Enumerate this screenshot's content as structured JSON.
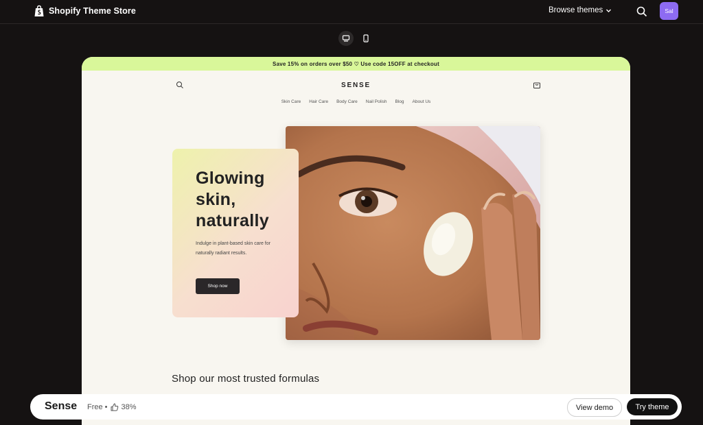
{
  "topbar": {
    "title": "Shopify Theme Store",
    "browse_label": "Browse themes",
    "avatar_initials": "Sal"
  },
  "device_toggle": {
    "desktop_icon": "desktop-icon",
    "mobile_icon": "mobile-icon",
    "active": "desktop"
  },
  "preview": {
    "announcement": "Save 15% on orders over $50 ♡ Use code 15OFF at checkout",
    "announcement_color": "#d9f79a",
    "store_logo": "SENSE",
    "nav": [
      "Skin Care",
      "Hair Care",
      "Body Care",
      "Nail Polish",
      "Blog",
      "About Us"
    ],
    "hero": {
      "title": "Glowing skin, naturally",
      "text": "Indulge in plant-based skin care for naturally radiant results.",
      "button": "Shop now"
    },
    "section_title": "Shop our most trusted formulas"
  },
  "bottom_bar": {
    "theme_name": "Sense",
    "price": "Free •",
    "rating": "38%",
    "view_demo": "View demo",
    "try_theme": "Try theme"
  }
}
